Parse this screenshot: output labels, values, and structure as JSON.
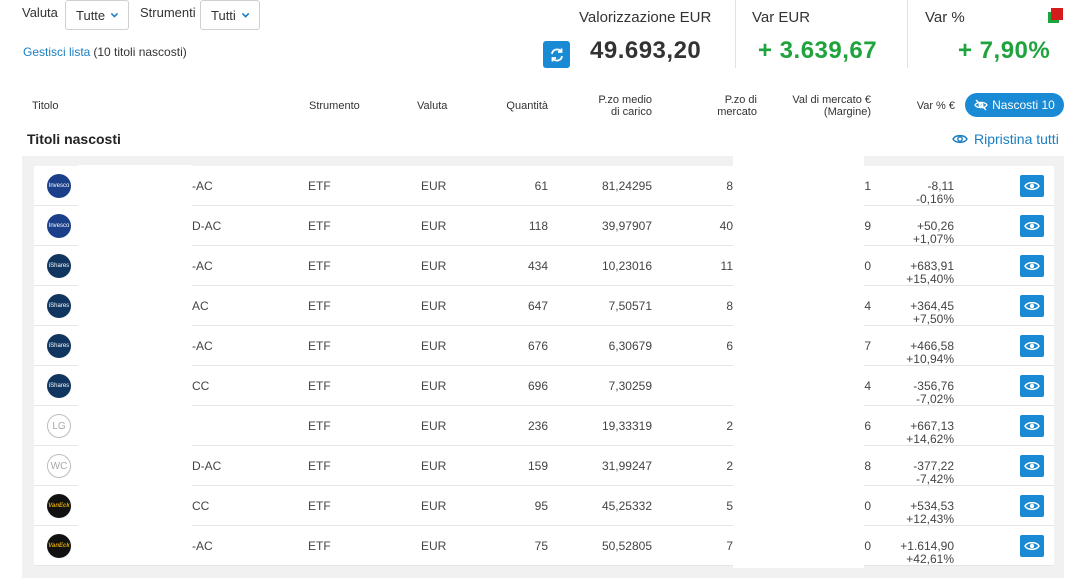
{
  "filters": {
    "valuta_label": "Valuta",
    "valuta_value": "Tutte",
    "strumenti_label": "Strumenti",
    "strumenti_value": "Tutti",
    "manage_link": "Gestisci lista",
    "hidden_count": "(10 titoli nascosti)"
  },
  "summary": {
    "valorizzazione_label": "Valorizzazione EUR",
    "valorizzazione_value": "49.693,20",
    "var_eur_label": "Var EUR",
    "var_eur_value": "+ 3.639,67",
    "var_pct_label": "Var %",
    "var_pct_value": "+ 7,90%",
    "gain_color": "#1fa33d",
    "status_color": "#d51c1c"
  },
  "columns": {
    "titolo": "Titolo",
    "strumento": "Strumento",
    "valuta": "Valuta",
    "quantita": "Quantità",
    "pzo_medio_1": "P.zo medio",
    "pzo_medio_2": "di carico",
    "pzo_mercato_1": "P.zo di",
    "pzo_mercato_2": "mercato",
    "val_mercato_1": "Val di mercato €",
    "val_mercato_2": "(Margine)",
    "var_pct": "Var % €",
    "nascosti_button": "Nascosti 10"
  },
  "section": {
    "title": "Titoli nascosti",
    "restore": "Ripristina tutti"
  },
  "rows": [
    {
      "logo": "invesco",
      "logo_text": "Invesco",
      "name": "-AC",
      "strumento": "ETF",
      "valuta": "EUR",
      "qty": "61",
      "pmc": "81,24295",
      "pm": "8",
      "vm": "1",
      "var_eur": "-8,11",
      "var_pct": "-0,16%"
    },
    {
      "logo": "invesco",
      "logo_text": "Invesco",
      "name": "D-AC",
      "strumento": "ETF",
      "valuta": "EUR",
      "qty": "118",
      "pmc": "39,97907",
      "pm": "40",
      "vm": "9",
      "var_eur": "+50,26",
      "var_pct": "+1,07%"
    },
    {
      "logo": "ishares",
      "logo_text": "iShares",
      "name": "-AC",
      "strumento": "ETF",
      "valuta": "EUR",
      "qty": "434",
      "pmc": "10,23016",
      "pm": "11",
      "vm": "0",
      "var_eur": "+683,91",
      "var_pct": "+15,40%"
    },
    {
      "logo": "ishares",
      "logo_text": "iShares",
      "name": "AC",
      "strumento": "ETF",
      "valuta": "EUR",
      "qty": "647",
      "pmc": "7,50571",
      "pm": "8",
      "vm": "4",
      "var_eur": "+364,45",
      "var_pct": "+7,50%"
    },
    {
      "logo": "ishares",
      "logo_text": "iShares",
      "name": "-AC",
      "strumento": "ETF",
      "valuta": "EUR",
      "qty": "676",
      "pmc": "6,30679",
      "pm": "6",
      "vm": "7",
      "var_eur": "+466,58",
      "var_pct": "+10,94%"
    },
    {
      "logo": "ishares",
      "logo_text": "iShares",
      "name": "CC",
      "strumento": "ETF",
      "valuta": "EUR",
      "qty": "696",
      "pmc": "7,30259",
      "pm": "",
      "vm": "4",
      "var_eur": "-356,76",
      "var_pct": "-7,02%"
    },
    {
      "logo": "lg",
      "logo_text": "LG",
      "name": "",
      "strumento": "ETF",
      "valuta": "EUR",
      "qty": "236",
      "pmc": "19,33319",
      "pm": "2",
      "vm": "6",
      "var_eur": "+667,13",
      "var_pct": "+14,62%"
    },
    {
      "logo": "wc",
      "logo_text": "WC",
      "name": "D-AC",
      "strumento": "ETF",
      "valuta": "EUR",
      "qty": "159",
      "pmc": "31,99247",
      "pm": "2",
      "vm": "8",
      "var_eur": "-377,22",
      "var_pct": "-7,42%"
    },
    {
      "logo": "vaneck",
      "logo_text": "VanEck",
      "name": "CC",
      "strumento": "ETF",
      "valuta": "EUR",
      "qty": "95",
      "pmc": "45,25332",
      "pm": "5",
      "vm": "0",
      "var_eur": "+534,53",
      "var_pct": "+12,43%"
    },
    {
      "logo": "vaneck",
      "logo_text": "VanEck",
      "name": "-AC",
      "strumento": "ETF",
      "valuta": "EUR",
      "qty": "75",
      "pmc": "50,52805",
      "pm": "7",
      "vm": "0",
      "var_eur": "+1.614,90",
      "var_pct": "+42,61%"
    }
  ]
}
